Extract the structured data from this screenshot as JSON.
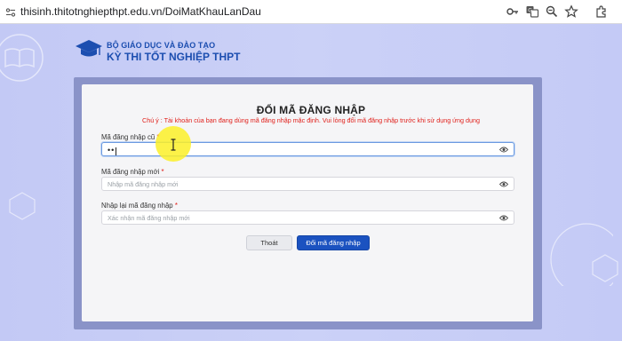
{
  "browser": {
    "url": "thisinh.thitotnghiepthpt.edu.vn/DoiMatKhauLanDau",
    "icons": [
      "site-settings-icon",
      "password-key-icon",
      "translate-icon",
      "zoom-icon",
      "bookmark-star-icon",
      "extensions-icon"
    ]
  },
  "header": {
    "line1": "BỘ GIÁO DỤC VÀ ĐÀO TẠO",
    "line2": "KỲ THI TỐT NGHIỆP THPT"
  },
  "form": {
    "title": "ĐỔI MÃ ĐĂNG NHẬP",
    "note": "Chú ý : Tài khoản của bạn đang dùng mã đăng nhập mặc định. Vui lòng đổi mã đăng nhập trước khi sử dụng ứng dụng",
    "fields": [
      {
        "label": "Mã đăng nhập cũ",
        "required": "*",
        "value": "••",
        "placeholder": ""
      },
      {
        "label": "Mã đăng nhập mới",
        "required": "*",
        "value": "",
        "placeholder": "Nhập mã đăng nhập mới"
      },
      {
        "label": "Nhập lại mã đăng nhập",
        "required": "*",
        "value": "",
        "placeholder": "Xác nhận mã đăng nhập mới"
      }
    ],
    "exit_label": "Thoát",
    "submit_label": "Đổi mã đăng nhập"
  },
  "colors": {
    "brand": "#1c4eb0",
    "primary_button": "#1b52c0",
    "warning": "#e0201b",
    "background": "#c7cdf6"
  }
}
